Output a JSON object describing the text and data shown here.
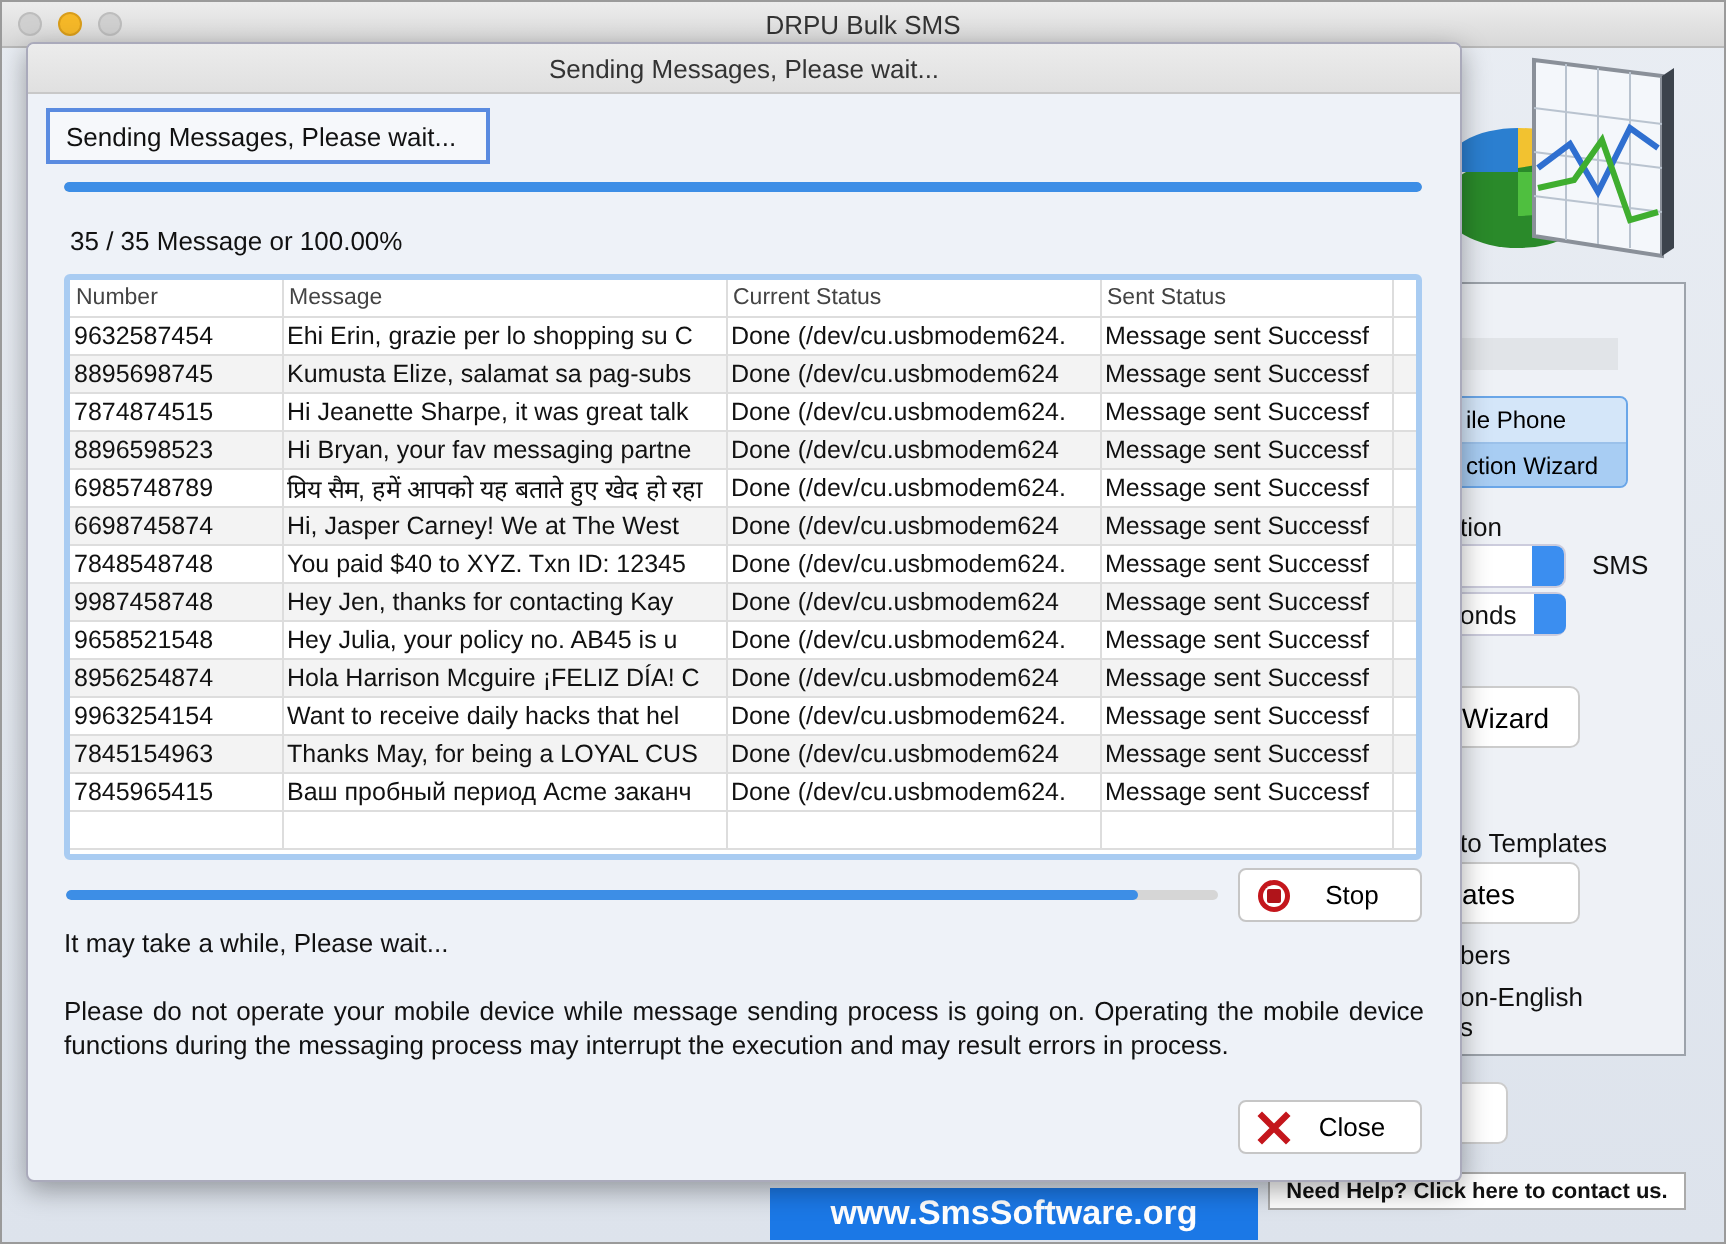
{
  "window": {
    "title": "DRPU Bulk SMS"
  },
  "background_panel": {
    "connection_button": {
      "lines": [
        "ile Phone",
        "ction  Wizard"
      ]
    },
    "section_label": "tion",
    "sms_label": "SMS",
    "delay_dropdown": {
      "value": "onds"
    },
    "wizard_button": "Wizard",
    "templates_label": "to Templates",
    "templates_button": "ates",
    "numbers_label": "bers",
    "non_english_label": [
      "on-English",
      "s"
    ]
  },
  "website_banner": "www.SmsSoftware.org",
  "help_link": "Need Help? Click here to contact us.",
  "dialog": {
    "title": "Sending Messages, Please wait...",
    "status_box": "Sending Messages, Please wait...",
    "overall_progress": {
      "level": 1
    },
    "count_text": "35 / 35 Message or 100.00%",
    "table": {
      "columns": [
        "Number",
        "Message",
        "Current Status",
        "Sent Status"
      ],
      "rows": [
        [
          "9632587454",
          "Ehi Erin, grazie per lo shopping su C",
          "Done (/dev/cu.usbmodem624.",
          "Message sent Successf"
        ],
        [
          "8895698745",
          "Kumusta Elize, salamat sa pag-subs",
          "Done (/dev/cu.usbmodem624",
          "Message sent Successf"
        ],
        [
          "7874874515",
          "Hi Jeanette Sharpe, it was great talk",
          "Done (/dev/cu.usbmodem624.",
          "Message sent Successf"
        ],
        [
          "8896598523",
          "Hi Bryan, your fav messaging partne",
          "Done (/dev/cu.usbmodem624",
          "Message sent Successf"
        ],
        [
          "6985748789",
          "प्रिय सैम, हमें आपको यह बताते हुए खेद हो रहा",
          "Done (/dev/cu.usbmodem624.",
          "Message sent Successf"
        ],
        [
          "6698745874",
          "Hi, Jasper Carney! We at The West",
          "Done (/dev/cu.usbmodem624",
          "Message sent Successf"
        ],
        [
          "7848548748",
          "You paid $40 to XYZ. Txn ID: 12345",
          "Done (/dev/cu.usbmodem624.",
          "Message sent Successf"
        ],
        [
          "9987458748",
          "Hey Jen, thanks for contacting Kay",
          "Done (/dev/cu.usbmodem624",
          "Message sent Successf"
        ],
        [
          "9658521548",
          "Hey Julia, your policy no. AB45 is u",
          "Done (/dev/cu.usbmodem624.",
          "Message sent Successf"
        ],
        [
          "8956254874",
          "Hola Harrison Mcguire ¡FELIZ DÍA! C",
          "Done (/dev/cu.usbmodem624",
          "Message sent Successf"
        ],
        [
          "9963254154",
          "Want to receive daily hacks that hel",
          "Done (/dev/cu.usbmodem624.",
          "Message sent Successf"
        ],
        [
          "7845154963",
          "Thanks May, for being a LOYAL CUS",
          "Done (/dev/cu.usbmodem624",
          "Message sent Successf"
        ],
        [
          "7845965415",
          "Ваш пробный период Acme заканч",
          "Done (/dev/cu.usbmodem624.",
          "Message sent Successf"
        ]
      ]
    },
    "batch_progress": {
      "level": 0.93
    },
    "stop_button": "Stop",
    "wait_text": "It may take a while, Please wait...",
    "notice": "Please do not operate your mobile device while message sending process is going on. Operating the mobile device functions during the messaging process may interrupt the execution and may result errors in process.",
    "close_button": "Close"
  }
}
